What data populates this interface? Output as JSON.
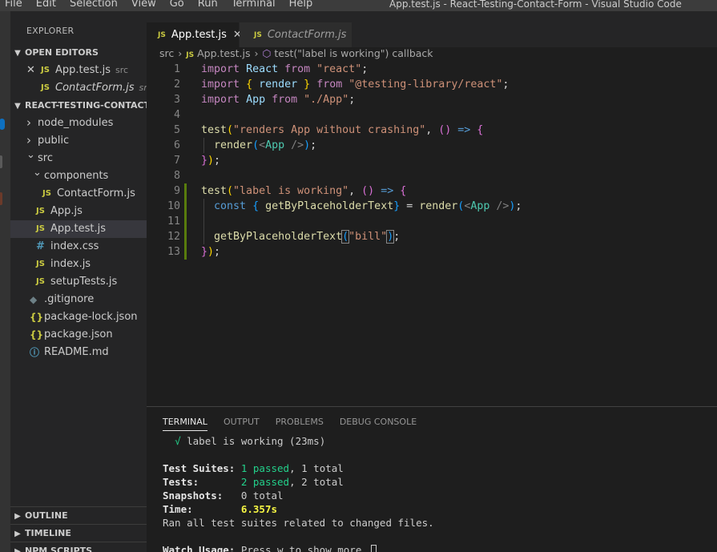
{
  "window": {
    "menu": [
      "File",
      "Edit",
      "Selection",
      "View",
      "Go",
      "Run",
      "Terminal",
      "Help"
    ],
    "title": "App.test.js - React-Testing-Contact-Form - Visual Studio Code"
  },
  "sidebar": {
    "header": "EXPLORER",
    "open_editors": {
      "title": "OPEN EDITORS",
      "items": [
        {
          "icon": "JS",
          "name": "App.test.js",
          "desc": "src",
          "close": "✕"
        },
        {
          "icon": "JS",
          "name": "ContactForm.js",
          "desc": "src..."
        }
      ]
    },
    "project": {
      "title": "REACT-TESTING-CONTACT...",
      "tree": [
        {
          "name": "node_modules",
          "type": "folder",
          "depth": 0,
          "expanded": false
        },
        {
          "name": "public",
          "type": "folder",
          "depth": 0,
          "expanded": false
        },
        {
          "name": "src",
          "type": "folder",
          "depth": 0,
          "expanded": true
        },
        {
          "name": "components",
          "type": "folder",
          "depth": 1,
          "expanded": true
        },
        {
          "name": "ContactForm.js",
          "type": "js",
          "depth": 2
        },
        {
          "name": "App.js",
          "type": "js",
          "depth": 1
        },
        {
          "name": "App.test.js",
          "type": "js",
          "depth": 1,
          "active": true
        },
        {
          "name": "index.css",
          "type": "css",
          "depth": 1
        },
        {
          "name": "index.js",
          "type": "js",
          "depth": 1
        },
        {
          "name": "setupTests.js",
          "type": "js",
          "depth": 1
        },
        {
          "name": ".gitignore",
          "type": "git",
          "depth": 0
        },
        {
          "name": "package-lock.json",
          "type": "json",
          "depth": 0
        },
        {
          "name": "package.json",
          "type": "json",
          "depth": 0
        },
        {
          "name": "README.md",
          "type": "info",
          "depth": 0
        }
      ]
    },
    "bottom_sections": [
      "OUTLINE",
      "TIMELINE",
      "NPM SCRIPTS"
    ]
  },
  "tabs": [
    {
      "icon": "JS",
      "label": "App.test.js",
      "active": true,
      "close": "✕"
    },
    {
      "icon": "JS",
      "label": "ContactForm.js",
      "active": false
    }
  ],
  "breadcrumb": {
    "folder": "src",
    "file_icon": "JS",
    "file": "App.test.js",
    "symbol": "test(\"label is working\") callback"
  },
  "editor": {
    "line_numbers": [
      "1",
      "2",
      "3",
      "4",
      "5",
      "6",
      "7",
      "8",
      "9",
      "10",
      "11",
      "12",
      "13"
    ],
    "modified_lines": [
      9,
      13
    ]
  },
  "panel": {
    "tabs": [
      "TERMINAL",
      "OUTPUT",
      "PROBLEMS",
      "DEBUG CONSOLE"
    ],
    "active_tab": "TERMINAL",
    "terminal": {
      "check_mark": "√",
      "test_result": "label is working (23ms)",
      "suites_label": "Test Suites:",
      "suites_passed": "1 passed",
      "suites_total": ", 1 total",
      "tests_label": "Tests:",
      "tests_passed": "2 passed",
      "tests_total": ", 2 total",
      "snapshots_label": "Snapshots:",
      "snapshots_value": "0 total",
      "time_label": "Time:",
      "time_value": "6.357s",
      "ran_all": "Ran all test suites related to changed files.",
      "watch_label": "Watch Usage:",
      "watch_text": "Press w to show more."
    }
  },
  "colors": {
    "editor_bg": "#1e1e1e",
    "sidebar_bg": "#252526",
    "keyword": "#c586c0",
    "function": "#dcdcaa",
    "string": "#ce9178",
    "pass_green": "#23d18b",
    "js_icon": "#cbcb41"
  }
}
